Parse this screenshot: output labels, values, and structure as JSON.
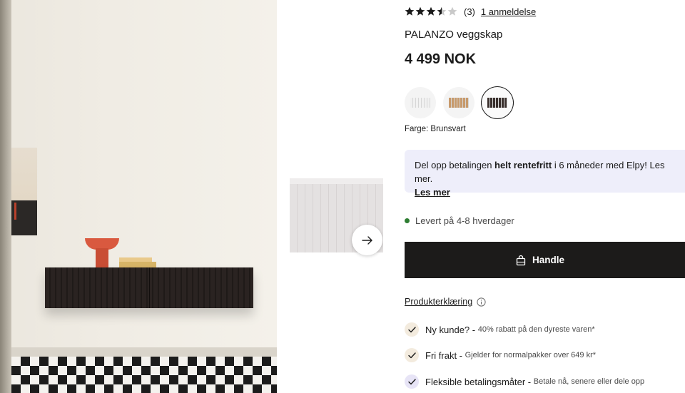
{
  "gallery": {
    "next_icon": "arrow-right-icon"
  },
  "product": {
    "rating": {
      "value": 3.5,
      "max": 5,
      "count": "(3)",
      "reviews_link": "1 anmeldelse"
    },
    "name": "PALANZO veggskap",
    "price": "4 499 NOK",
    "swatches": [
      {
        "name": "white",
        "color": "#f1f1f1"
      },
      {
        "name": "oak",
        "color": "#c79a6c"
      },
      {
        "name": "brown-black",
        "color": "#3a302d",
        "selected": true
      }
    ],
    "color_label": "Farge: Brunsvart"
  },
  "financing": {
    "text_before": "Del opp betalingen ",
    "text_bold": "helt rentefritt",
    "text_after": " i 6 måneder med Elpy! Les mer.",
    "link": "Les mer"
  },
  "delivery": {
    "text": "Levert på 4-8 hverdager",
    "status_color": "#2e7d32"
  },
  "buy_button": {
    "label": "Handle",
    "icon": "shopping-bag-icon"
  },
  "product_declaration": {
    "label": "Produkterklæring",
    "icon": "info-icon"
  },
  "usps": [
    {
      "title": "Ny kunde?",
      "desc": "40% rabatt på den dyreste varen*"
    },
    {
      "title": "Fri frakt",
      "desc": "Gjelder for normalpakker over 649 kr*"
    },
    {
      "title": "Fleksible betalingsmåter",
      "desc": "Betale nå, senere eller dele opp"
    }
  ],
  "colors": {
    "buy_bg": "#1c1b1a",
    "financing_bg": "#eeeefa",
    "check_bg": "#f3ebde",
    "check_bg_purple": "#e7e4f6"
  }
}
